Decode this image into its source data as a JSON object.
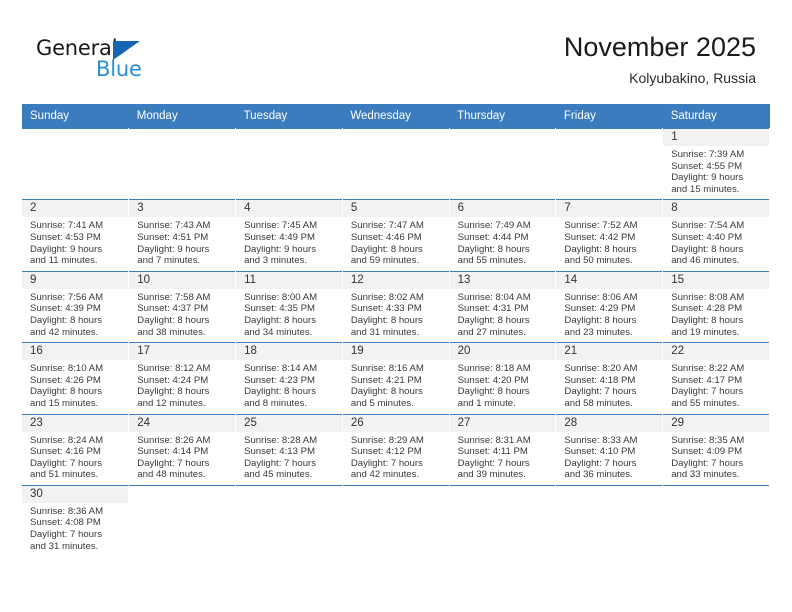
{
  "brand": {
    "name_primary": "General",
    "name_secondary": "Blue",
    "triangle_color": "#1665b5",
    "secondary_color": "#2b8fd6"
  },
  "header": {
    "month_title": "November 2025",
    "location": "Kolyubakino, Russia"
  },
  "theme": {
    "header_blue": "#3b7cbf",
    "daynum_band": "#f2f2f2"
  },
  "weekday_headers": [
    "Sunday",
    "Monday",
    "Tuesday",
    "Wednesday",
    "Thursday",
    "Friday",
    "Saturday"
  ],
  "weeks": [
    [
      {
        "blank": true
      },
      {
        "blank": true
      },
      {
        "blank": true
      },
      {
        "blank": true
      },
      {
        "blank": true
      },
      {
        "blank": true
      },
      {
        "day": "1",
        "sunrise": "Sunrise: 7:39 AM",
        "sunset": "Sunset: 4:55 PM",
        "daylight_line1": "Daylight: 9 hours",
        "daylight_line2": "and 15 minutes."
      }
    ],
    [
      {
        "day": "2",
        "sunrise": "Sunrise: 7:41 AM",
        "sunset": "Sunset: 4:53 PM",
        "daylight_line1": "Daylight: 9 hours",
        "daylight_line2": "and 11 minutes."
      },
      {
        "day": "3",
        "sunrise": "Sunrise: 7:43 AM",
        "sunset": "Sunset: 4:51 PM",
        "daylight_line1": "Daylight: 9 hours",
        "daylight_line2": "and 7 minutes."
      },
      {
        "day": "4",
        "sunrise": "Sunrise: 7:45 AM",
        "sunset": "Sunset: 4:49 PM",
        "daylight_line1": "Daylight: 9 hours",
        "daylight_line2": "and 3 minutes."
      },
      {
        "day": "5",
        "sunrise": "Sunrise: 7:47 AM",
        "sunset": "Sunset: 4:46 PM",
        "daylight_line1": "Daylight: 8 hours",
        "daylight_line2": "and 59 minutes."
      },
      {
        "day": "6",
        "sunrise": "Sunrise: 7:49 AM",
        "sunset": "Sunset: 4:44 PM",
        "daylight_line1": "Daylight: 8 hours",
        "daylight_line2": "and 55 minutes."
      },
      {
        "day": "7",
        "sunrise": "Sunrise: 7:52 AM",
        "sunset": "Sunset: 4:42 PM",
        "daylight_line1": "Daylight: 8 hours",
        "daylight_line2": "and 50 minutes."
      },
      {
        "day": "8",
        "sunrise": "Sunrise: 7:54 AM",
        "sunset": "Sunset: 4:40 PM",
        "daylight_line1": "Daylight: 8 hours",
        "daylight_line2": "and 46 minutes."
      }
    ],
    [
      {
        "day": "9",
        "sunrise": "Sunrise: 7:56 AM",
        "sunset": "Sunset: 4:39 PM",
        "daylight_line1": "Daylight: 8 hours",
        "daylight_line2": "and 42 minutes."
      },
      {
        "day": "10",
        "sunrise": "Sunrise: 7:58 AM",
        "sunset": "Sunset: 4:37 PM",
        "daylight_line1": "Daylight: 8 hours",
        "daylight_line2": "and 38 minutes."
      },
      {
        "day": "11",
        "sunrise": "Sunrise: 8:00 AM",
        "sunset": "Sunset: 4:35 PM",
        "daylight_line1": "Daylight: 8 hours",
        "daylight_line2": "and 34 minutes."
      },
      {
        "day": "12",
        "sunrise": "Sunrise: 8:02 AM",
        "sunset": "Sunset: 4:33 PM",
        "daylight_line1": "Daylight: 8 hours",
        "daylight_line2": "and 31 minutes."
      },
      {
        "day": "13",
        "sunrise": "Sunrise: 8:04 AM",
        "sunset": "Sunset: 4:31 PM",
        "daylight_line1": "Daylight: 8 hours",
        "daylight_line2": "and 27 minutes."
      },
      {
        "day": "14",
        "sunrise": "Sunrise: 8:06 AM",
        "sunset": "Sunset: 4:29 PM",
        "daylight_line1": "Daylight: 8 hours",
        "daylight_line2": "and 23 minutes."
      },
      {
        "day": "15",
        "sunrise": "Sunrise: 8:08 AM",
        "sunset": "Sunset: 4:28 PM",
        "daylight_line1": "Daylight: 8 hours",
        "daylight_line2": "and 19 minutes."
      }
    ],
    [
      {
        "day": "16",
        "sunrise": "Sunrise: 8:10 AM",
        "sunset": "Sunset: 4:26 PM",
        "daylight_line1": "Daylight: 8 hours",
        "daylight_line2": "and 15 minutes."
      },
      {
        "day": "17",
        "sunrise": "Sunrise: 8:12 AM",
        "sunset": "Sunset: 4:24 PM",
        "daylight_line1": "Daylight: 8 hours",
        "daylight_line2": "and 12 minutes."
      },
      {
        "day": "18",
        "sunrise": "Sunrise: 8:14 AM",
        "sunset": "Sunset: 4:23 PM",
        "daylight_line1": "Daylight: 8 hours",
        "daylight_line2": "and 8 minutes."
      },
      {
        "day": "19",
        "sunrise": "Sunrise: 8:16 AM",
        "sunset": "Sunset: 4:21 PM",
        "daylight_line1": "Daylight: 8 hours",
        "daylight_line2": "and 5 minutes."
      },
      {
        "day": "20",
        "sunrise": "Sunrise: 8:18 AM",
        "sunset": "Sunset: 4:20 PM",
        "daylight_line1": "Daylight: 8 hours",
        "daylight_line2": "and 1 minute."
      },
      {
        "day": "21",
        "sunrise": "Sunrise: 8:20 AM",
        "sunset": "Sunset: 4:18 PM",
        "daylight_line1": "Daylight: 7 hours",
        "daylight_line2": "and 58 minutes."
      },
      {
        "day": "22",
        "sunrise": "Sunrise: 8:22 AM",
        "sunset": "Sunset: 4:17 PM",
        "daylight_line1": "Daylight: 7 hours",
        "daylight_line2": "and 55 minutes."
      }
    ],
    [
      {
        "day": "23",
        "sunrise": "Sunrise: 8:24 AM",
        "sunset": "Sunset: 4:16 PM",
        "daylight_line1": "Daylight: 7 hours",
        "daylight_line2": "and 51 minutes."
      },
      {
        "day": "24",
        "sunrise": "Sunrise: 8:26 AM",
        "sunset": "Sunset: 4:14 PM",
        "daylight_line1": "Daylight: 7 hours",
        "daylight_line2": "and 48 minutes."
      },
      {
        "day": "25",
        "sunrise": "Sunrise: 8:28 AM",
        "sunset": "Sunset: 4:13 PM",
        "daylight_line1": "Daylight: 7 hours",
        "daylight_line2": "and 45 minutes."
      },
      {
        "day": "26",
        "sunrise": "Sunrise: 8:29 AM",
        "sunset": "Sunset: 4:12 PM",
        "daylight_line1": "Daylight: 7 hours",
        "daylight_line2": "and 42 minutes."
      },
      {
        "day": "27",
        "sunrise": "Sunrise: 8:31 AM",
        "sunset": "Sunset: 4:11 PM",
        "daylight_line1": "Daylight: 7 hours",
        "daylight_line2": "and 39 minutes."
      },
      {
        "day": "28",
        "sunrise": "Sunrise: 8:33 AM",
        "sunset": "Sunset: 4:10 PM",
        "daylight_line1": "Daylight: 7 hours",
        "daylight_line2": "and 36 minutes."
      },
      {
        "day": "29",
        "sunrise": "Sunrise: 8:35 AM",
        "sunset": "Sunset: 4:09 PM",
        "daylight_line1": "Daylight: 7 hours",
        "daylight_line2": "and 33 minutes."
      }
    ],
    [
      {
        "day": "30",
        "sunrise": "Sunrise: 8:36 AM",
        "sunset": "Sunset: 4:08 PM",
        "daylight_line1": "Daylight: 7 hours",
        "daylight_line2": "and 31 minutes."
      },
      {
        "blank": true
      },
      {
        "blank": true
      },
      {
        "blank": true
      },
      {
        "blank": true
      },
      {
        "blank": true
      },
      {
        "blank": true
      }
    ]
  ]
}
